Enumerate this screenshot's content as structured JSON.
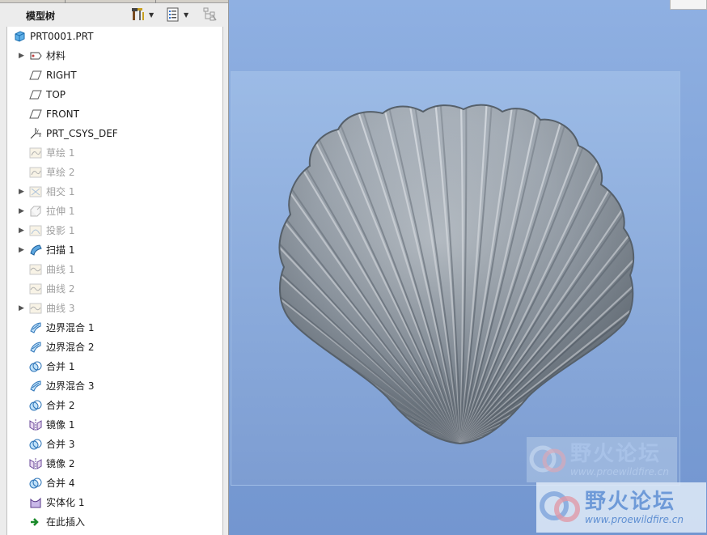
{
  "model_tree": {
    "title": "模型树",
    "root": {
      "label": "PRT0001.PRT",
      "icon": "part-icon"
    },
    "items": [
      {
        "label": "材料",
        "icon": "material-icon",
        "expandable": true,
        "suppressed": false
      },
      {
        "label": "RIGHT",
        "icon": "datum-plane-icon",
        "expandable": false,
        "suppressed": false
      },
      {
        "label": "TOP",
        "icon": "datum-plane-icon",
        "expandable": false,
        "suppressed": false
      },
      {
        "label": "FRONT",
        "icon": "datum-plane-icon",
        "expandable": false,
        "suppressed": false
      },
      {
        "label": "PRT_CSYS_DEF",
        "icon": "csys-icon",
        "expandable": false,
        "suppressed": false
      },
      {
        "label": "草绘 1",
        "icon": "sketch-icon",
        "expandable": false,
        "suppressed": true
      },
      {
        "label": "草绘 2",
        "icon": "sketch-icon",
        "expandable": false,
        "suppressed": true
      },
      {
        "label": "相交 1",
        "icon": "intersect-icon",
        "expandable": true,
        "suppressed": true
      },
      {
        "label": "拉伸 1",
        "icon": "extrude-icon",
        "expandable": true,
        "suppressed": true
      },
      {
        "label": "投影 1",
        "icon": "project-icon",
        "expandable": true,
        "suppressed": true
      },
      {
        "label": "扫描 1",
        "icon": "sweep-icon",
        "expandable": true,
        "suppressed": false
      },
      {
        "label": "曲线 1",
        "icon": "curve-icon",
        "expandable": false,
        "suppressed": true
      },
      {
        "label": "曲线 2",
        "icon": "curve-icon",
        "expandable": false,
        "suppressed": true
      },
      {
        "label": "曲线 3",
        "icon": "curve-icon",
        "expandable": true,
        "suppressed": true
      },
      {
        "label": "边界混合 1",
        "icon": "boundary-blend-icon",
        "expandable": false,
        "suppressed": false
      },
      {
        "label": "边界混合 2",
        "icon": "boundary-blend-icon",
        "expandable": false,
        "suppressed": false
      },
      {
        "label": "合并 1",
        "icon": "merge-icon",
        "expandable": false,
        "suppressed": false
      },
      {
        "label": "边界混合 3",
        "icon": "boundary-blend-icon",
        "expandable": false,
        "suppressed": false
      },
      {
        "label": "合并 2",
        "icon": "merge-icon",
        "expandable": false,
        "suppressed": false
      },
      {
        "label": "镜像 1",
        "icon": "mirror-icon",
        "expandable": false,
        "suppressed": false
      },
      {
        "label": "合并 3",
        "icon": "merge-icon",
        "expandable": false,
        "suppressed": false
      },
      {
        "label": "镜像 2",
        "icon": "mirror-icon",
        "expandable": false,
        "suppressed": false
      },
      {
        "label": "合并 4",
        "icon": "merge-icon",
        "expandable": false,
        "suppressed": false
      },
      {
        "label": "实体化 1",
        "icon": "solidify-icon",
        "expandable": false,
        "suppressed": false
      },
      {
        "label": "在此插入",
        "icon": "insert-here-icon",
        "expandable": false,
        "suppressed": false
      }
    ]
  },
  "toolbar": {
    "settings_icon": "settings-tools-icon",
    "show_icon": "show-list-icon",
    "filter_icon": "tree-filter-icon"
  },
  "viewport": {
    "model": "scallop-shell-surface",
    "watermark_cn": "野火论坛",
    "watermark_url": "www.proewildfire.cn"
  },
  "colors": {
    "viewport_bg": "#7fa3d8",
    "shell": "#8e9aa6",
    "suppressed_text": "#a0a0a0"
  }
}
